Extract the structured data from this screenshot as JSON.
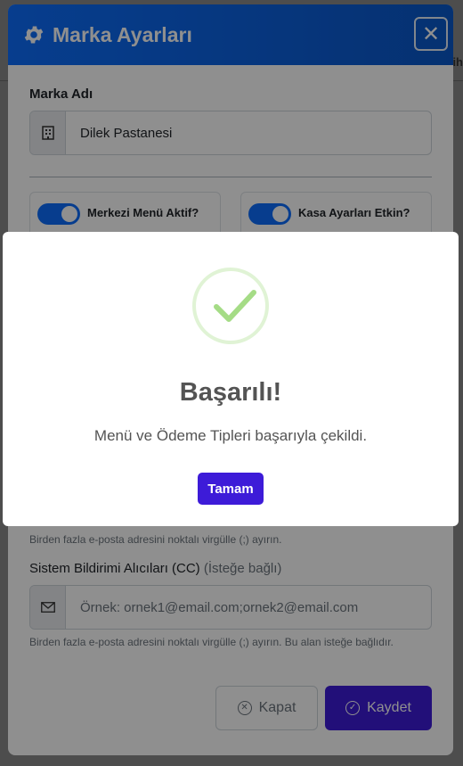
{
  "background": {
    "peek_text": "ih"
  },
  "modal": {
    "title": "Marka Ayarları",
    "close_glyph": "✕",
    "brand_name_label": "Marka Adı",
    "brand_name_value": "Dilek Pastanesi",
    "brand_icon": "building-icon",
    "toggles": [
      {
        "label": "Merkezi Menü Aktif?",
        "on": true
      },
      {
        "label": "Kasa Ayarları Etkin?",
        "on": true
      }
    ],
    "help_text_1": "Birden fazla e-posta adresini noktalı virgülle (;) ayırın.",
    "cc_label": "Sistem Bildirimi Alıcıları (CC)",
    "cc_optional": "(İsteğe bağlı)",
    "cc_placeholder": "Örnek: ornek1@email.com;ornek2@email.com",
    "help_text_2": "Birden fazla e-posta adresini noktalı virgülle (;) ayırın. Bu alan isteğe bağlıdır.",
    "close_button": "Kapat",
    "save_button": "Kaydet",
    "accent_color": "#0d6efd",
    "save_color": "#3d1bd8"
  },
  "alert": {
    "title": "Başarılı!",
    "message": "Menü ve Ödeme Tipleri başarıyla çekildi.",
    "ok_button": "Tamam",
    "icon": "success-check-icon"
  }
}
